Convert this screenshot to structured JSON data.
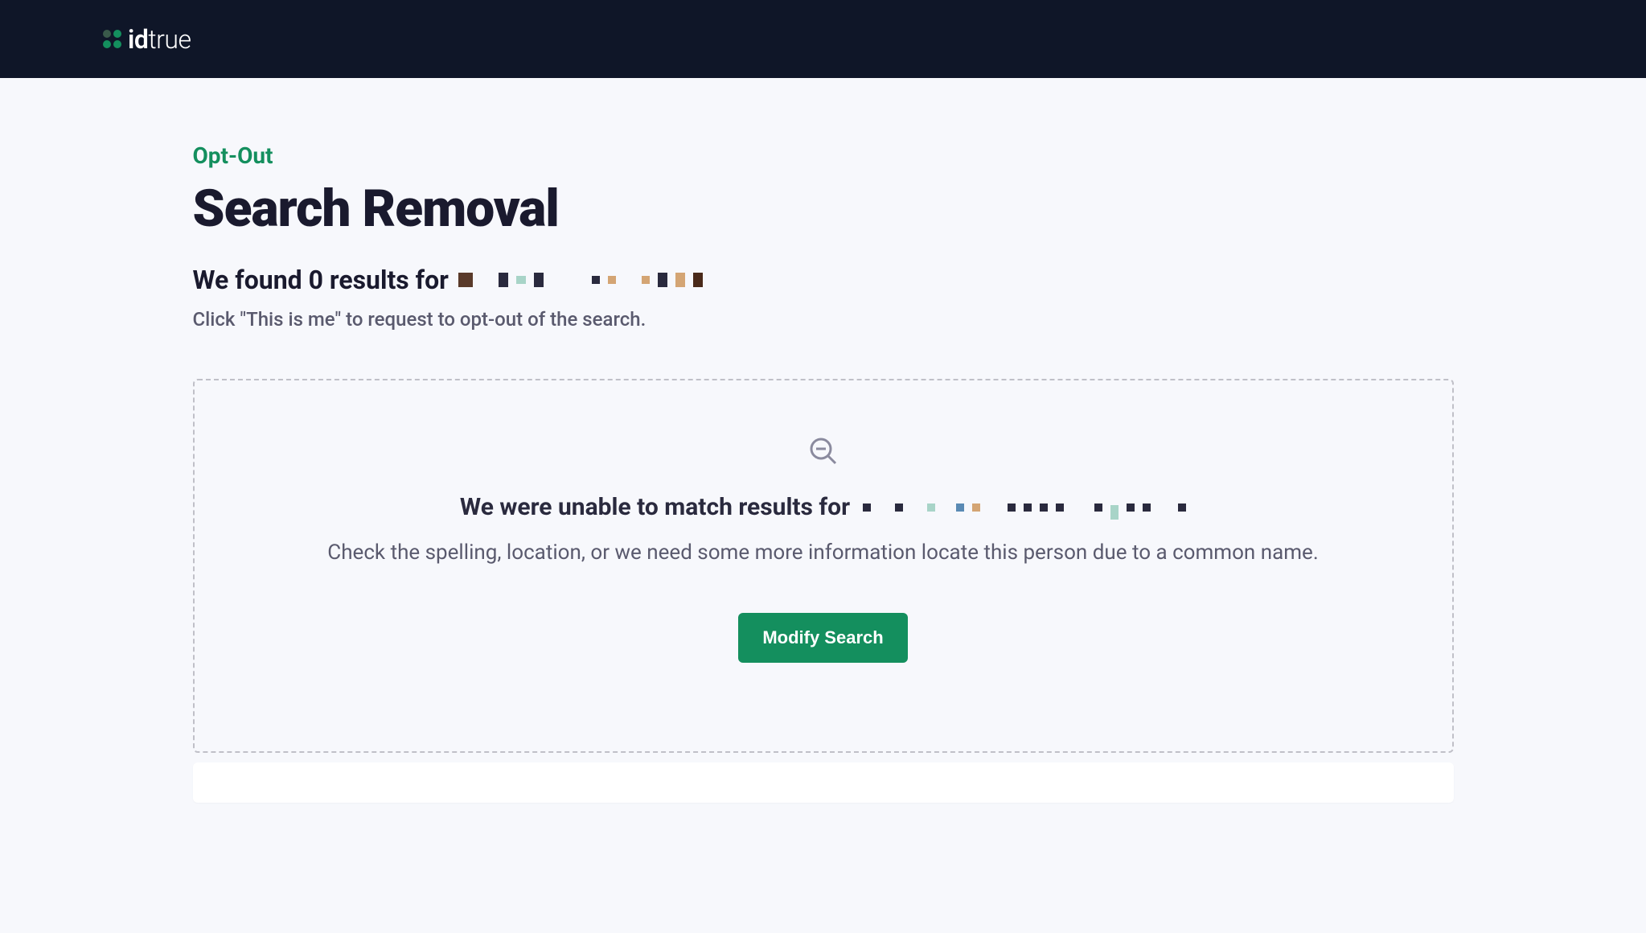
{
  "brand": {
    "name_part1": "id",
    "name_part2": "true"
  },
  "page": {
    "opt_out_label": "Opt-Out",
    "title": "Search Removal",
    "results_count": 0,
    "results_heading_prefix": "We found 0 results for",
    "instruction": "Click \"This is me\" to request to opt-out of the search."
  },
  "empty_state": {
    "heading_prefix": "We were unable to match results for",
    "subtext": "Check the spelling, location, or we need some more information locate this person due to a common name.",
    "button_label": "Modify Search"
  }
}
